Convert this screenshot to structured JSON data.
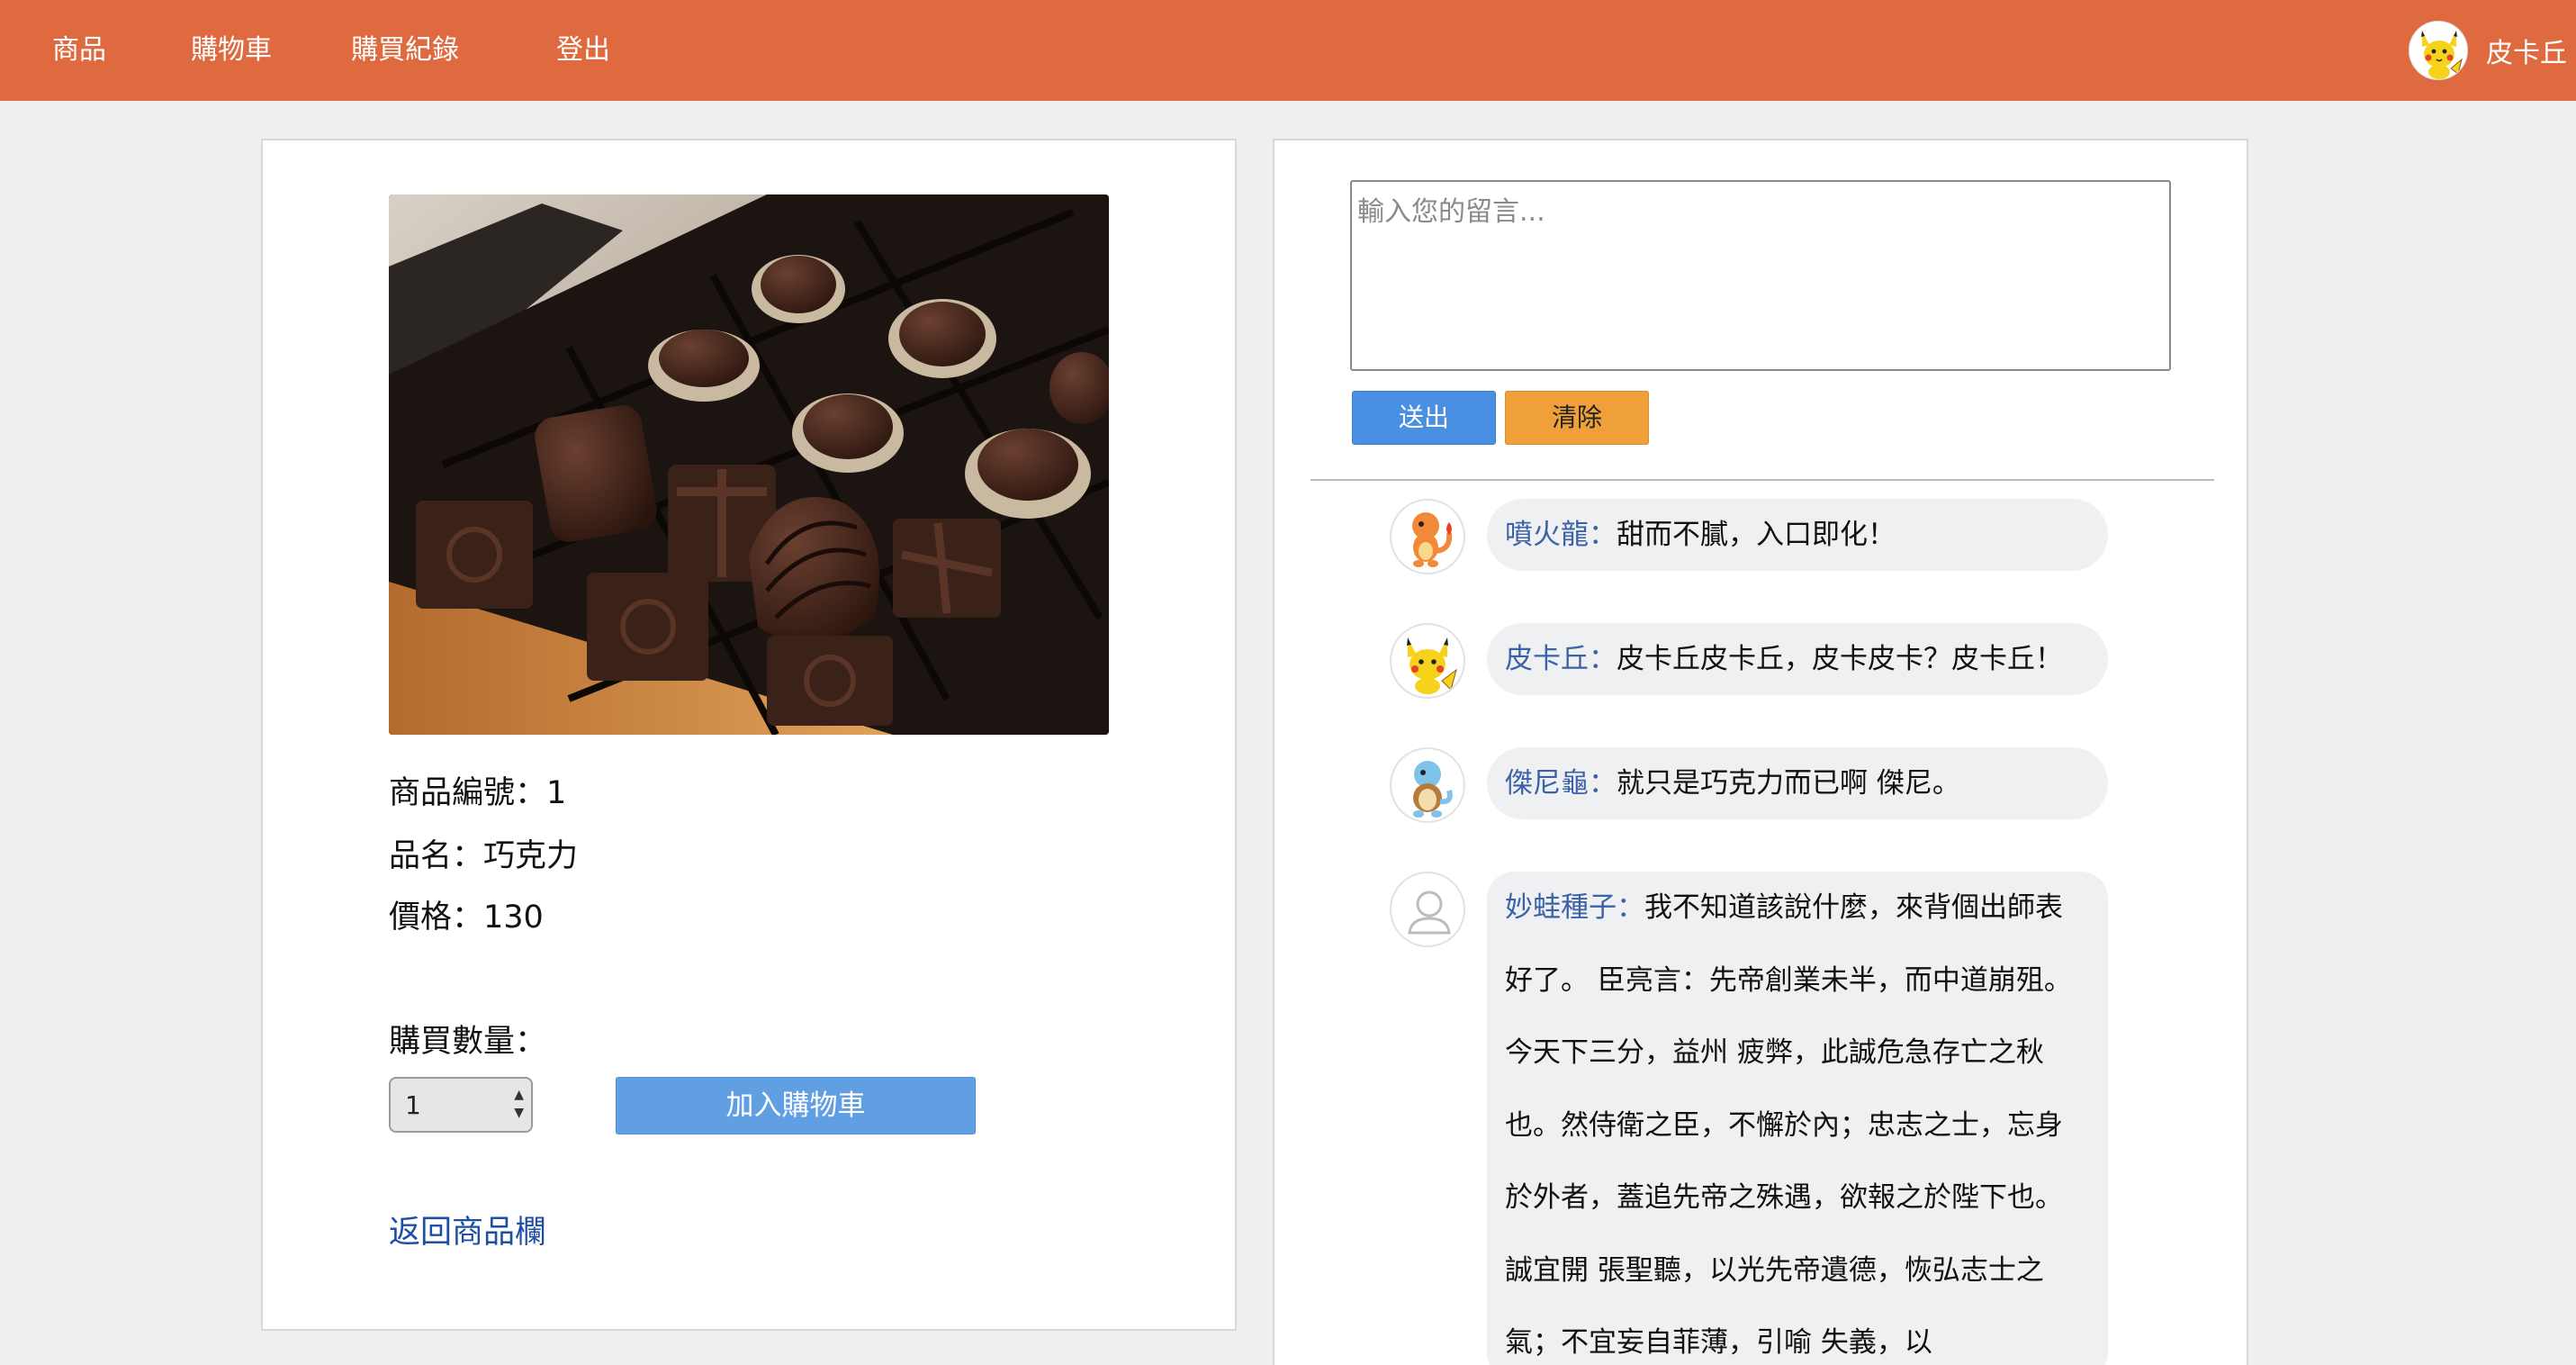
{
  "nav": {
    "items": [
      "商品",
      "購物車",
      "購買紀錄",
      "登出"
    ],
    "user_name": "皮卡丘",
    "user_avatar_icon": "pikachu-avatar-icon"
  },
  "colors": {
    "nav_bg": "#e06a3f",
    "send_button": "#4a90e2",
    "clear_button": "#f0a03a",
    "add_to_cart_button": "#609fe2",
    "commenter_name": "#3b62a7",
    "link": "#1d4fa3"
  },
  "product": {
    "image_icon": "chocolate-box-photo",
    "id_line": "商品編號：1",
    "name_line": "品名：巧克力",
    "price_line": "價格：130",
    "quantity_label": "購買數量：",
    "quantity_value": "1",
    "quantity_options": [
      "1"
    ],
    "add_to_cart_label": "加入購物車",
    "back_link_label": "返回商品欄"
  },
  "comment_form": {
    "placeholder": "輸入您的留言...",
    "send_label": "送出",
    "clear_label": "清除"
  },
  "comments": [
    {
      "name": "噴火龍：",
      "text": "甜而不膩，入口即化！",
      "avatar_icon": "charmander-avatar-icon"
    },
    {
      "name": "皮卡丘：",
      "text": "皮卡丘皮卡丘，皮卡皮卡？皮卡丘！",
      "avatar_icon": "pikachu-avatar-icon"
    },
    {
      "name": "傑尼龜：",
      "text": "就只是巧克力而已啊 傑尼。",
      "avatar_icon": "squirtle-avatar-icon"
    },
    {
      "name": "妙蛙種子：",
      "text": "我不知道該說什麼，來背個出師表好了。 臣亮言：先帝創業未半，而中道崩殂。今天下三分，益州 疲弊，此誠危急存亡之秋也。然侍衛之臣，不懈於內；忠志之士，忘身於外者，蓋追先帝之殊遇，欲報之於陛下也。誠宜開 張聖聽，以光先帝遺德，恢弘志士之氣；不宜妄自菲薄，引喻 失義，以",
      "avatar_icon": "default-user-avatar-icon"
    }
  ]
}
